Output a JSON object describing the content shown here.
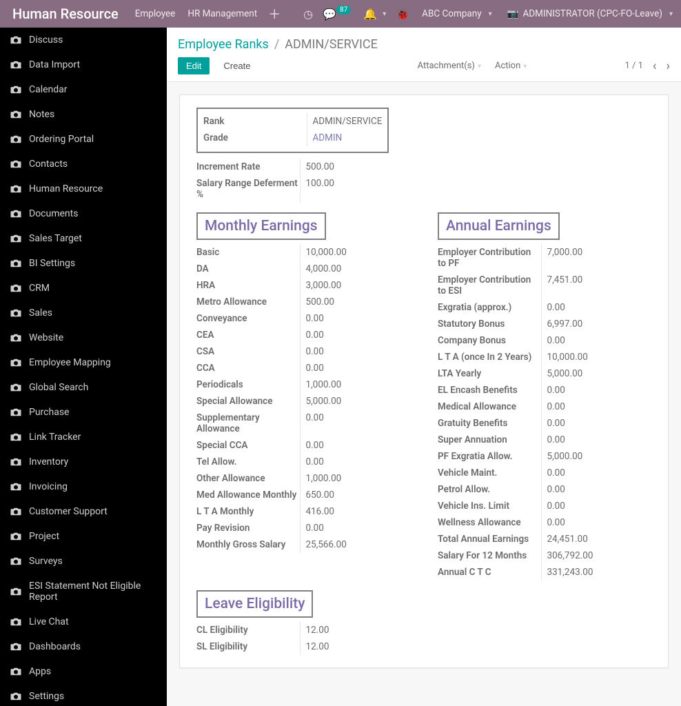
{
  "topbar": {
    "brand": "Human Resource",
    "menus": [
      "Employee",
      "HR Management"
    ],
    "msg_count": "87",
    "company": "ABC Company",
    "user": "ADMINISTRATOR (CPC-FO-Leave)"
  },
  "sidebar": {
    "items": [
      "Discuss",
      "Data Import",
      "Calendar",
      "Notes",
      "Ordering Portal",
      "Contacts",
      "Human Resource",
      "Documents",
      "Sales Target",
      "BI Settings",
      "CRM",
      "Sales",
      "Website",
      "Employee Mapping",
      "Global Search",
      "Purchase",
      "Link Tracker",
      "Inventory",
      "Invoicing",
      "Customer Support",
      "Project",
      "Surveys",
      "ESI Statement Not Eligible Report",
      "Live Chat",
      "Dashboards",
      "Apps",
      "Settings"
    ]
  },
  "breadcrumbs": {
    "root": "Employee Ranks",
    "current": "ADMIN/SERVICE"
  },
  "buttons": {
    "edit": "Edit",
    "create": "Create",
    "attachments": "Attachment(s)",
    "action": "Action"
  },
  "pager": "1 / 1",
  "record": {
    "header": {
      "rank_label": "Rank",
      "rank": "ADMIN/SERVICE",
      "grade_label": "Grade",
      "grade": "ADMIN",
      "inc_label": "Increment Rate",
      "inc": "500.00",
      "def_label": "Salary Range Deferment %",
      "def": "100.00"
    },
    "monthly_title": "Monthly Earnings",
    "annual_title": "Annual Earnings",
    "leave_title": "Leave Eligibility",
    "monthly": [
      {
        "l": "Basic",
        "v": "10,000.00"
      },
      {
        "l": "DA",
        "v": "4,000.00"
      },
      {
        "l": "HRA",
        "v": "3,000.00"
      },
      {
        "l": "Metro Allowance",
        "v": "500.00"
      },
      {
        "l": "Conveyance",
        "v": "0.00"
      },
      {
        "l": "CEA",
        "v": "0.00"
      },
      {
        "l": "CSA",
        "v": "0.00"
      },
      {
        "l": "CCA",
        "v": "0.00"
      },
      {
        "l": "Periodicals",
        "v": "1,000.00"
      },
      {
        "l": "Special Allowance",
        "v": "5,000.00"
      },
      {
        "l": "Supplementary Allowance",
        "v": "0.00"
      },
      {
        "l": "Special CCA",
        "v": "0.00"
      },
      {
        "l": "Tel Allow.",
        "v": "0.00"
      },
      {
        "l": "Other Allowance",
        "v": "1,000.00"
      },
      {
        "l": "Med Allowance Monthly",
        "v": "650.00"
      },
      {
        "l": "L T A Monthly",
        "v": "416.00"
      },
      {
        "l": "Pay Revision",
        "v": "0.00"
      },
      {
        "l": "Monthly Gross Salary",
        "v": "25,566.00"
      }
    ],
    "annual": [
      {
        "l": "Employer Contribution to PF",
        "v": "7,000.00"
      },
      {
        "l": "Employer Contribution to ESI",
        "v": "7,451.00"
      },
      {
        "l": "Exgratia (approx.)",
        "v": "0.00"
      },
      {
        "l": "Statutory Bonus",
        "v": "6,997.00"
      },
      {
        "l": "Company Bonus",
        "v": "0.00"
      },
      {
        "l": "L T A (once In 2 Years)",
        "v": "10,000.00"
      },
      {
        "l": "LTA Yearly",
        "v": "5,000.00"
      },
      {
        "l": "EL Encash Benefits",
        "v": "0.00"
      },
      {
        "l": "Medical Allowance",
        "v": "0.00"
      },
      {
        "l": "Gratuity Benefits",
        "v": "0.00"
      },
      {
        "l": "Super Annuation",
        "v": "0.00"
      },
      {
        "l": "PF Exgratia Allow.",
        "v": "5,000.00"
      },
      {
        "l": "Vehicle Maint.",
        "v": "0.00"
      },
      {
        "l": "Petrol Allow.",
        "v": "0.00"
      },
      {
        "l": "Vehicle Ins. Limit",
        "v": "0.00"
      },
      {
        "l": "Wellness Allowance",
        "v": "0.00"
      },
      {
        "l": "Total Annual Earnings",
        "v": "24,451.00"
      },
      {
        "l": "Salary For 12 Months",
        "v": "306,792.00"
      },
      {
        "l": "Annual C T C",
        "v": "331,243.00"
      }
    ],
    "leave": [
      {
        "l": "CL Eligibility",
        "v": "12.00"
      },
      {
        "l": "SL Eligibility",
        "v": "12.00"
      }
    ]
  }
}
